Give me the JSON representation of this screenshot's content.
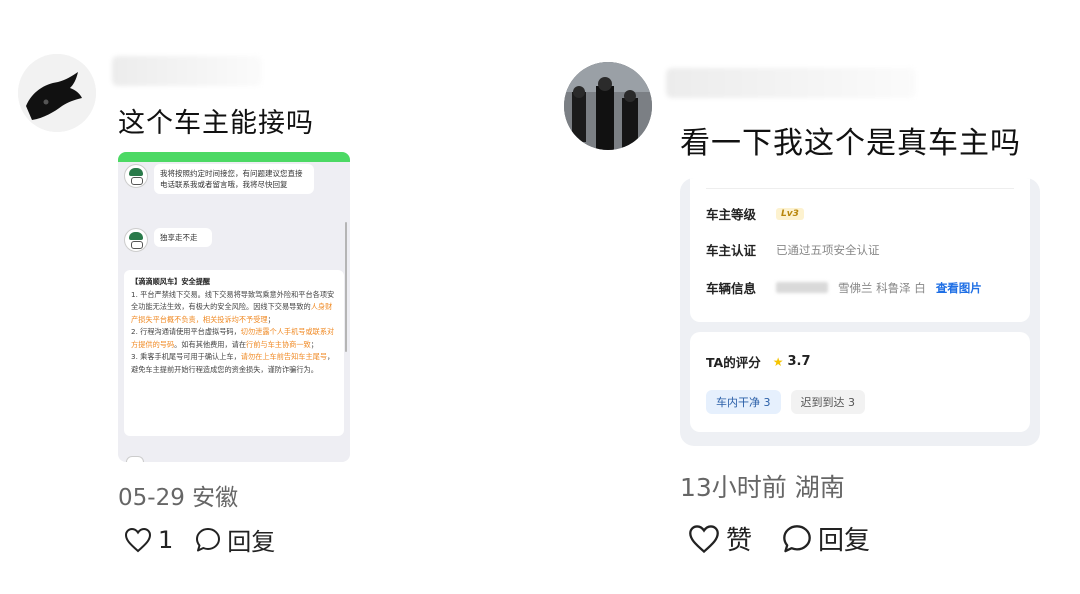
{
  "comments": [
    {
      "text": "这个车主能接吗",
      "date": "05-29",
      "location": "安徽",
      "like_count": "1",
      "reply_label": "回复",
      "screenshot": {
        "messages": [
          "我将按照约定时间接您，有问题建议您直接电话联系我或者留言哦，我将尽快回复",
          "独享走不走"
        ],
        "notice": {
          "title": "【滴滴顺风车】安全提醒",
          "p1": "1. 平台严禁线下交易。线下交易将导致驾乘意外险和平台各项安全功能无法生效，有极大的安全风险。因线下交易导致的",
          "p1_orange": "人身财产损失平台概不负责，相关投诉均不予受理",
          "p1_end": "；",
          "p2": "2. 行程沟通请使用平台虚拟号码，",
          "p2_orange": "切勿泄露个人手机号或联系对方提供的号码",
          "p2_mid": "。如有其他费用，请在",
          "p2_orange2": "行前与车主协商一致",
          "p2_end": "；",
          "p3": "3. 乘客手机尾号可用于确认上车，",
          "p3_orange": "请勿在上车前告知车主尾号",
          "p3_end": "，避免车主提前开始行程造成您的资金损失，谨防诈骗行为。"
        }
      }
    },
    {
      "text": "看一下我这个是真车主吗",
      "time": "13小时前",
      "location": "湖南",
      "like_label": "赞",
      "reply_label": "回复",
      "screenshot": {
        "level_label": "车主等级",
        "level_value": "Lv3",
        "cert_label": "车主认证",
        "cert_value": "已通过五项安全认证",
        "vehicle_label": "车辆信息",
        "vehicle_value": "雪佛兰 科鲁泽 白",
        "vehicle_link": "查看图片",
        "rating_label": "TA的评分",
        "rating_value": "3.7",
        "tags": [
          "车内干净 3",
          "迟到到达 3"
        ]
      }
    }
  ],
  "icons": {
    "heart": "heart-outline-icon",
    "reply": "speech-bubble-icon",
    "star": "star-icon"
  },
  "colors": {
    "chat_top_bar": "#4cd964",
    "warning_orange": "#f08a24",
    "link_blue": "#1f6fe5",
    "star_yellow": "#f5c400"
  }
}
